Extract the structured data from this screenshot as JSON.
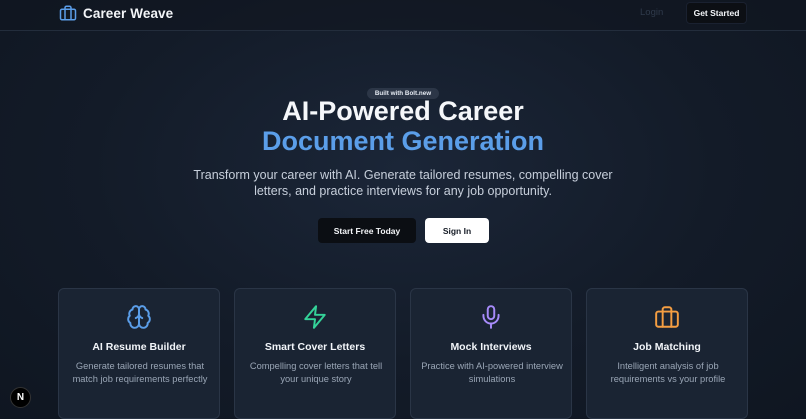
{
  "nav": {
    "brand": "Career Weave",
    "login": "Login",
    "get_started": "Get Started"
  },
  "hero": {
    "badge": "Built with Bolt.new",
    "title_line1": "AI-Powered Career",
    "title_line2": "Document Generation",
    "subtitle": "Transform your career with AI. Generate tailored resumes, compelling cover letters, and practice interviews for any job opportunity.",
    "primary_cta": "Start Free Today",
    "secondary_cta": "Sign In"
  },
  "features": [
    {
      "icon": "brain-icon",
      "title": "AI Resume Builder",
      "desc": "Generate tailored resumes that match job requirements perfectly",
      "color": "#5b9ee9"
    },
    {
      "icon": "zap-icon",
      "title": "Smart Cover Letters",
      "desc": "Compelling cover letters that tell your unique story",
      "color": "#34d399"
    },
    {
      "icon": "mic-icon",
      "title": "Mock Interviews",
      "desc": "Practice with AI-powered interview simulations",
      "color": "#a78bfa"
    },
    {
      "icon": "briefcase-icon",
      "title": "Job Matching",
      "desc": "Intelligent analysis of job requirements vs your profile",
      "color": "#f59e42"
    }
  ],
  "dev_badge": "N",
  "colors": {
    "accent": "#5b9ee9",
    "brand_icon": "#5b9ee9"
  }
}
